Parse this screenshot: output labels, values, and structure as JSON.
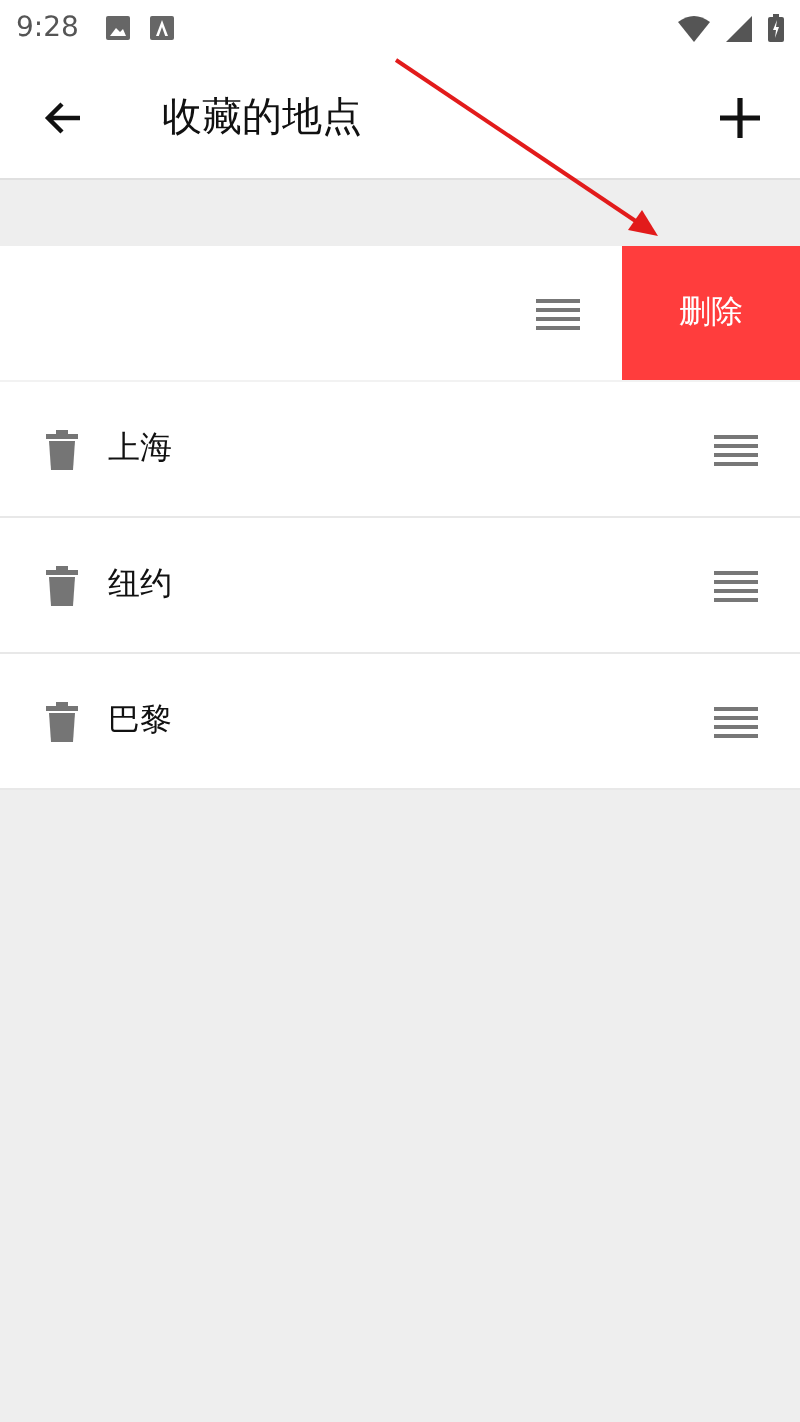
{
  "status_bar": {
    "time": "9:28"
  },
  "app_bar": {
    "title": "收藏的地点"
  },
  "swiped_row": {
    "action": "删除"
  },
  "places": [
    {
      "name": "上海"
    },
    {
      "name": "纽约"
    },
    {
      "name": "巴黎"
    }
  ]
}
